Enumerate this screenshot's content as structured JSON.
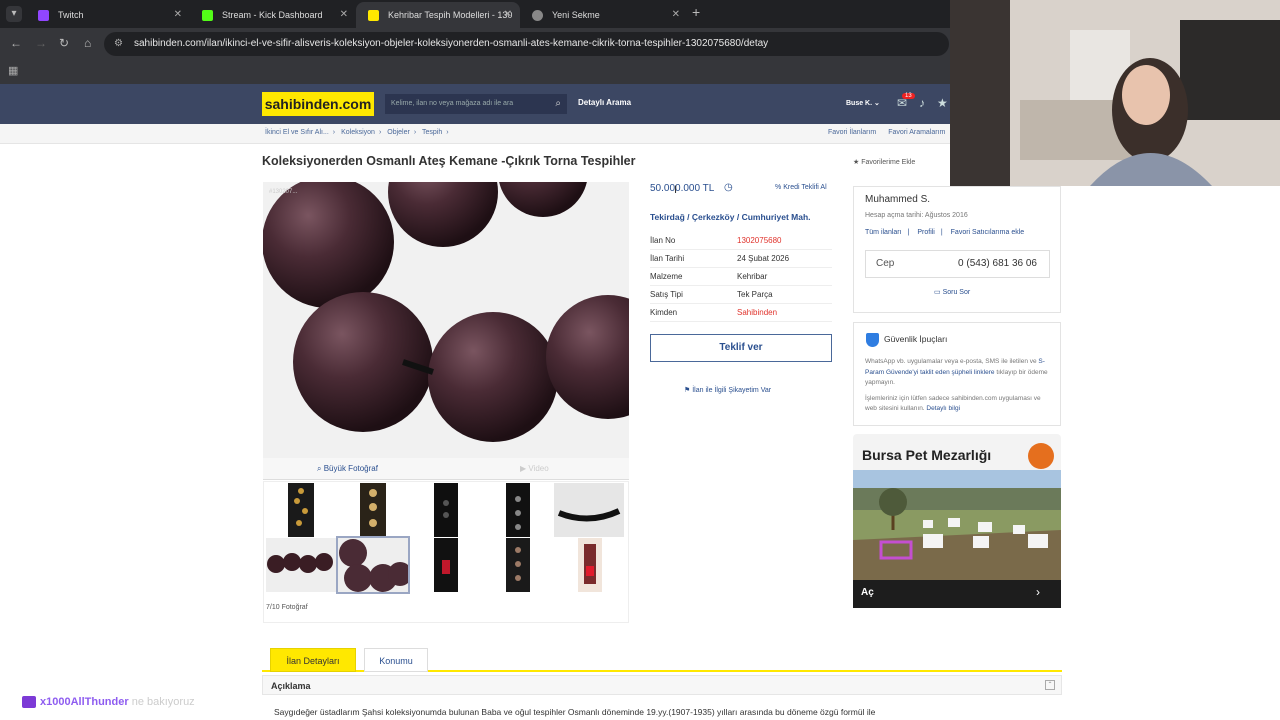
{
  "browser": {
    "tabs": [
      {
        "label": "Twitch",
        "color": "#9146ff",
        "active": false
      },
      {
        "label": "Stream - Kick Dashboard",
        "color": "#53fc18",
        "active": false
      },
      {
        "label": "Kehribar Tespih Modelleri - 130",
        "color": "#ffe800",
        "active": true
      },
      {
        "label": "Yeni Sekme",
        "color": "#888888",
        "active": false
      }
    ],
    "url": "sahibinden.com/ilan/ikinci-el-ve-sifir-alisveris-koleksiyon-objeler-koleksiyonerden-osmanli-ates-kemane-cikrik-torna-tespihler-1302075680/detay"
  },
  "site": {
    "logo": "sahibinden.com",
    "search_placeholder": "Kelime, ilan no veya mağaza adı ile ara",
    "advanced_search": "Detaylı Arama",
    "user": "Buse K.",
    "notifications": "13"
  },
  "breadcrumbs": [
    "İkinci El ve Sıfır Alı...",
    "Koleksiyon",
    "Objeler",
    "Tespih"
  ],
  "fav_links": [
    "Favori İlanlarım",
    "Favori Aramalarım"
  ],
  "listing": {
    "title": "Koleksiyonerden Osmanlı Ateş Kemane -Çıkrık Torna Tespihler",
    "add_fav": "Favorilerime Ekle",
    "photo_no": "#130207...",
    "price": "50.000.000 TL",
    "credit": "Kredi Teklifi Al",
    "location": [
      "Tekirdağ",
      "Çerkezköy",
      "Cumhuriyet Mah."
    ],
    "location_sep": "/",
    "details": [
      {
        "k": "İlan No",
        "v": "1302075680",
        "red": true
      },
      {
        "k": "İlan Tarihi",
        "v": "24 Şubat 2026",
        "red": false
      },
      {
        "k": "Malzeme",
        "v": "Kehribar",
        "red": false
      },
      {
        "k": "Satış Tipi",
        "v": "Tek Parça",
        "red": false
      },
      {
        "k": "Kimden",
        "v": "Sahibinden",
        "red": true
      }
    ],
    "offer_button": "Teklif ver",
    "complaint": "İlan ile İlgili Şikayetim Var",
    "big_photo": "Büyük Fotoğraf",
    "video": "Video",
    "photo_count": "7/10 Fotoğraf"
  },
  "seller": {
    "name": "Muhammed S.",
    "since": "Hesap açma tarihi: Ağustos 2016",
    "links": [
      "Tüm ilanları",
      "Profili",
      "Favori Satıcılarıma ekle"
    ],
    "phone_label": "Cep",
    "phone": "0 (543) 681 36 06",
    "ask": "Soru Sor"
  },
  "safety": {
    "title": "Güvenlik İpuçları",
    "p1_a": "WhatsApp vb. uygulamalar veya e-posta, SMS ile iletilen ve ",
    "p1_link1": "S-Param Güvende'yi taklit eden şüpheli linklere",
    "p1_b": " tıklayıp bir ödeme yapmayın.",
    "p2_a": "İşlemleriniz için lütfen sadece sahibinden.com uygulaması ve web sitesini kullanın. ",
    "p2_link": "Detaylı bilgi"
  },
  "ad": {
    "title": "Bursa Pet Mezarlığı",
    "cta": "Aç"
  },
  "detail_tabs": [
    "İlan Detayları",
    "Konumu"
  ],
  "description": {
    "heading": "Açıklama",
    "text": "Saygıdeğer üstadlarım Şahsi koleksiyonumda bulunan Baba ve oğul tespihler Osmanlı döneminde 19.yy.(1907-1935) yılları arasında bu döneme özgü formül ile"
  },
  "chat": {
    "user": "x1000AllThunder",
    "message": "ne bakıyoruz"
  },
  "colors": {
    "brand": "#ffe800",
    "header": "#3c4763",
    "link": "#2a4f8f",
    "red": "#e0332c"
  }
}
